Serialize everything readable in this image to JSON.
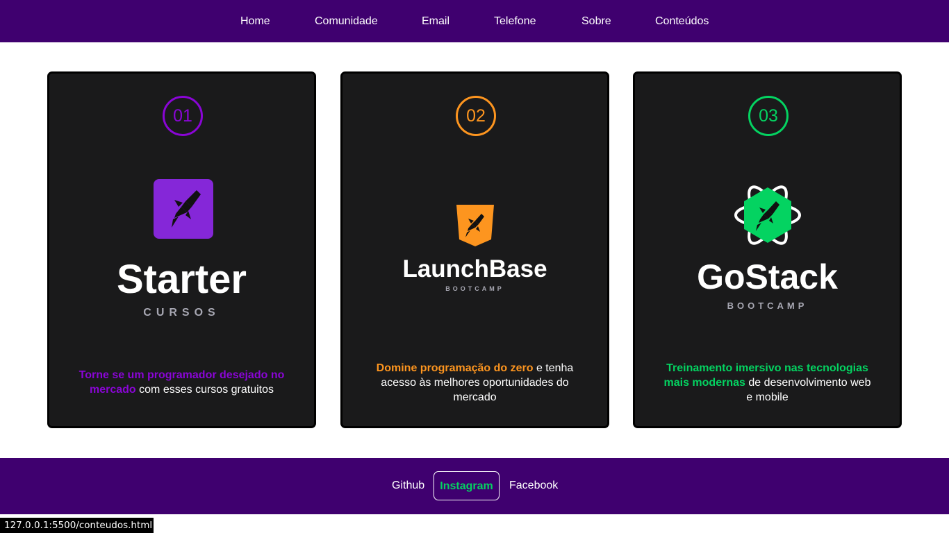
{
  "nav": {
    "items": [
      {
        "label": "Home"
      },
      {
        "label": "Comunidade"
      },
      {
        "label": "Email"
      },
      {
        "label": "Telefone"
      },
      {
        "label": "Sobre"
      },
      {
        "label": "Conteúdos"
      }
    ]
  },
  "colors": {
    "header_bg": "#3f006f",
    "card_bg": "#1a1a1b",
    "purple": "#8257e5",
    "orange": "#fd951f",
    "green": "#04d361"
  },
  "cards": [
    {
      "number": "01",
      "icon": "rocket-logo-square-icon",
      "brand": "Starter",
      "subtitle": "CURSOS",
      "highlight": "Torne se um programador desejado no mercado",
      "text": " com esses cursos gratuitos",
      "accent": "#8a05d6"
    },
    {
      "number": "02",
      "icon": "rocket-logo-shield-icon",
      "brand": "LaunchBase",
      "subtitle": "BOOTCAMP",
      "highlight": "Domine programação do zero",
      "text": " e tenha acesso às melhores oportunidades do mercado",
      "accent": "#fd951f"
    },
    {
      "number": "03",
      "icon": "rocket-logo-atom-hexagon-icon",
      "brand": "GoStack",
      "subtitle": "BOOTCAMP",
      "highlight": "Treinamento imersivo nas tecnologias mais modernas",
      "text": " de desenvolvimento web e mobile",
      "accent": "#04d361"
    }
  ],
  "footer": {
    "links": [
      {
        "label": "Github"
      },
      {
        "label": "Instagram",
        "active": true
      },
      {
        "label": "Facebook"
      }
    ]
  },
  "status_url": "127.0.0.1:5500/conteudos.html"
}
